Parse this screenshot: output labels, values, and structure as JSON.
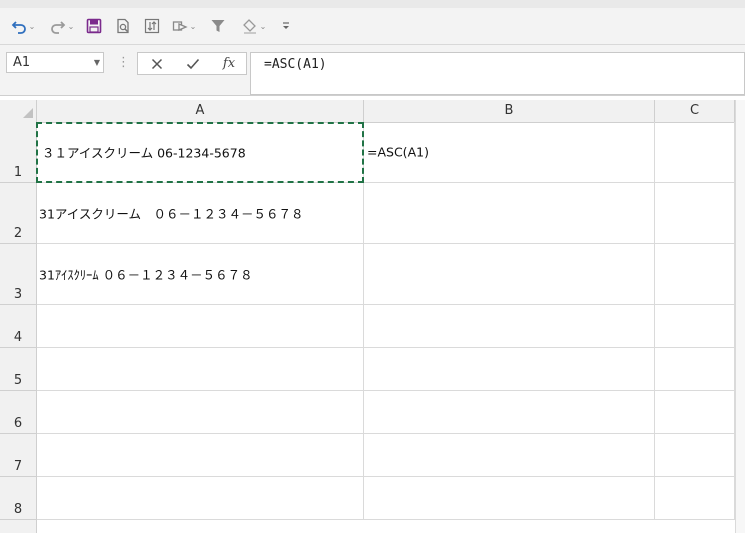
{
  "toolbar": {
    "icons": [
      "undo-icon",
      "redo-icon",
      "save-icon",
      "print-preview-icon",
      "sort-icon",
      "shapes-icon",
      "filter-icon",
      "fill-color-icon",
      "customize-icon"
    ]
  },
  "formula_bar": {
    "name_box": "A1",
    "formula": "=ASC(A1)",
    "fx_label": "fx"
  },
  "columns": [
    "A",
    "B",
    "C"
  ],
  "rows": [
    {
      "number": "1",
      "cells": [
        "３１アイスクリーム 06-1234-5678",
        "=ASC(A1)",
        ""
      ]
    },
    {
      "number": "2",
      "cells": [
        "31アイスクリーム　０６－１２３４－５６７８",
        "",
        ""
      ]
    },
    {
      "number": "3",
      "cells": [
        "31ｱｲｽｸﾘｰﾑ ０６－１２３４－５６７８",
        "",
        ""
      ]
    },
    {
      "number": "4",
      "cells": [
        "",
        "",
        ""
      ]
    },
    {
      "number": "5",
      "cells": [
        "",
        "",
        ""
      ]
    },
    {
      "number": "6",
      "cells": [
        "",
        "",
        ""
      ]
    },
    {
      "number": "7",
      "cells": [
        "",
        "",
        ""
      ]
    },
    {
      "number": "8",
      "cells": [
        "",
        "",
        ""
      ]
    }
  ],
  "selection": {
    "cell": "A1",
    "style": "copy-marquee"
  },
  "colors": {
    "selection": "#217346",
    "undo": "#2f6fbe",
    "save": "#7b2a8c"
  }
}
